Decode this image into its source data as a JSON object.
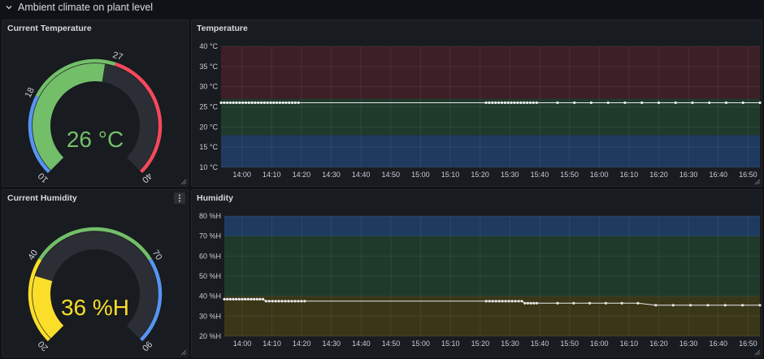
{
  "row": {
    "title": "Ambient climate on plant level"
  },
  "gauges": [
    {
      "title": "Current Temperature",
      "value": 26,
      "min": 10,
      "max": 40,
      "value_text": "26 °C",
      "color": "#73bf69",
      "ticks": [
        {
          "v": 10,
          "label": "10"
        },
        {
          "v": 18,
          "label": "18"
        },
        {
          "v": 27,
          "label": "27"
        },
        {
          "v": 40,
          "label": "40"
        }
      ],
      "bands": [
        {
          "from": 10,
          "to": 18,
          "color": "#5794f2"
        },
        {
          "from": 18,
          "to": 27,
          "color": "#73bf69"
        },
        {
          "from": 27,
          "to": 40,
          "color": "#f2495c"
        }
      ]
    },
    {
      "title": "Current Humidity",
      "value": 36,
      "min": 20,
      "max": 90,
      "value_text": "36 %H",
      "color": "#fade2a",
      "ticks": [
        {
          "v": 20,
          "label": "20"
        },
        {
          "v": 40,
          "label": "40"
        },
        {
          "v": 70,
          "label": "70"
        },
        {
          "v": 90,
          "label": "90"
        }
      ],
      "bands": [
        {
          "from": 20,
          "to": 40,
          "color": "#fade2a"
        },
        {
          "from": 40,
          "to": 70,
          "color": "#73bf69"
        },
        {
          "from": 70,
          "to": 90,
          "color": "#5794f2"
        }
      ]
    }
  ],
  "chart_data": [
    {
      "type": "line",
      "title": "Temperature",
      "ylim": [
        10,
        40
      ],
      "y_ticks": [
        {
          "v": 10,
          "label": "10 °C"
        },
        {
          "v": 15,
          "label": "15 °C"
        },
        {
          "v": 20,
          "label": "20 °C"
        },
        {
          "v": 25,
          "label": "25 °C"
        },
        {
          "v": 30,
          "label": "30 °C"
        },
        {
          "v": 35,
          "label": "35 °C"
        },
        {
          "v": 40,
          "label": "40 °C"
        }
      ],
      "x_range": [
        "13:53",
        "16:54"
      ],
      "x_ticks": [
        "14:00",
        "14:10",
        "14:20",
        "14:30",
        "14:40",
        "14:50",
        "15:00",
        "15:10",
        "15:20",
        "15:30",
        "15:40",
        "15:50",
        "16:00",
        "16:10",
        "16:20",
        "16:30",
        "16:40",
        "16:50"
      ],
      "bands": [
        {
          "from": 10,
          "to": 18,
          "color": "#1e3a5f"
        },
        {
          "from": 18,
          "to": 27,
          "color": "#1f3a2a"
        },
        {
          "from": 27,
          "to": 40,
          "color": "#3d1f27"
        }
      ],
      "grid": true,
      "series": [
        {
          "color": "#e8e8e8",
          "segments": [
            {
              "start": "13:53",
              "end": "14:19",
              "count": 26,
              "value": 26
            },
            {
              "start": "15:22",
              "end": "15:39",
              "count": 17,
              "value": 26
            },
            {
              "start": "15:46",
              "end": "16:54",
              "count": 13,
              "value": 26
            }
          ]
        }
      ]
    },
    {
      "type": "line",
      "title": "Humidity",
      "ylim": [
        20,
        80
      ],
      "y_ticks": [
        {
          "v": 20,
          "label": "20 %H"
        },
        {
          "v": 30,
          "label": "30 %H"
        },
        {
          "v": 40,
          "label": "40 %H"
        },
        {
          "v": 50,
          "label": "50 %H"
        },
        {
          "v": 60,
          "label": "60 %H"
        },
        {
          "v": 70,
          "label": "70 %H"
        },
        {
          "v": 80,
          "label": "80 %H"
        }
      ],
      "x_range": [
        "13:54",
        "16:54"
      ],
      "x_ticks": [
        "14:00",
        "14:10",
        "14:20",
        "14:30",
        "14:40",
        "14:50",
        "15:00",
        "15:10",
        "15:20",
        "15:30",
        "15:40",
        "15:50",
        "16:00",
        "16:10",
        "16:20",
        "16:30",
        "16:40",
        "16:50"
      ],
      "bands": [
        {
          "from": 20,
          "to": 40,
          "color": "#3a3618"
        },
        {
          "from": 40,
          "to": 70,
          "color": "#1f3a2a"
        },
        {
          "from": 70,
          "to": 80,
          "color": "#1e3a5f"
        }
      ],
      "grid": true,
      "series": [
        {
          "color": "#e8e8e8",
          "segments": [
            {
              "start": "13:54",
              "end": "14:07",
              "count": 14,
              "value": 38.5
            },
            {
              "start": "14:08",
              "end": "14:21",
              "count": 13,
              "value": 37.5
            },
            {
              "start": "15:22",
              "end": "15:34",
              "count": 12,
              "value": 37.5
            },
            {
              "start": "15:35",
              "end": "15:39",
              "count": 5,
              "value": 36.5
            },
            {
              "start": "15:46",
              "end": "16:13",
              "count": 6,
              "value": 36.5
            },
            {
              "start": "16:19",
              "end": "16:54",
              "count": 7,
              "value": 35.5
            }
          ]
        }
      ]
    }
  ]
}
